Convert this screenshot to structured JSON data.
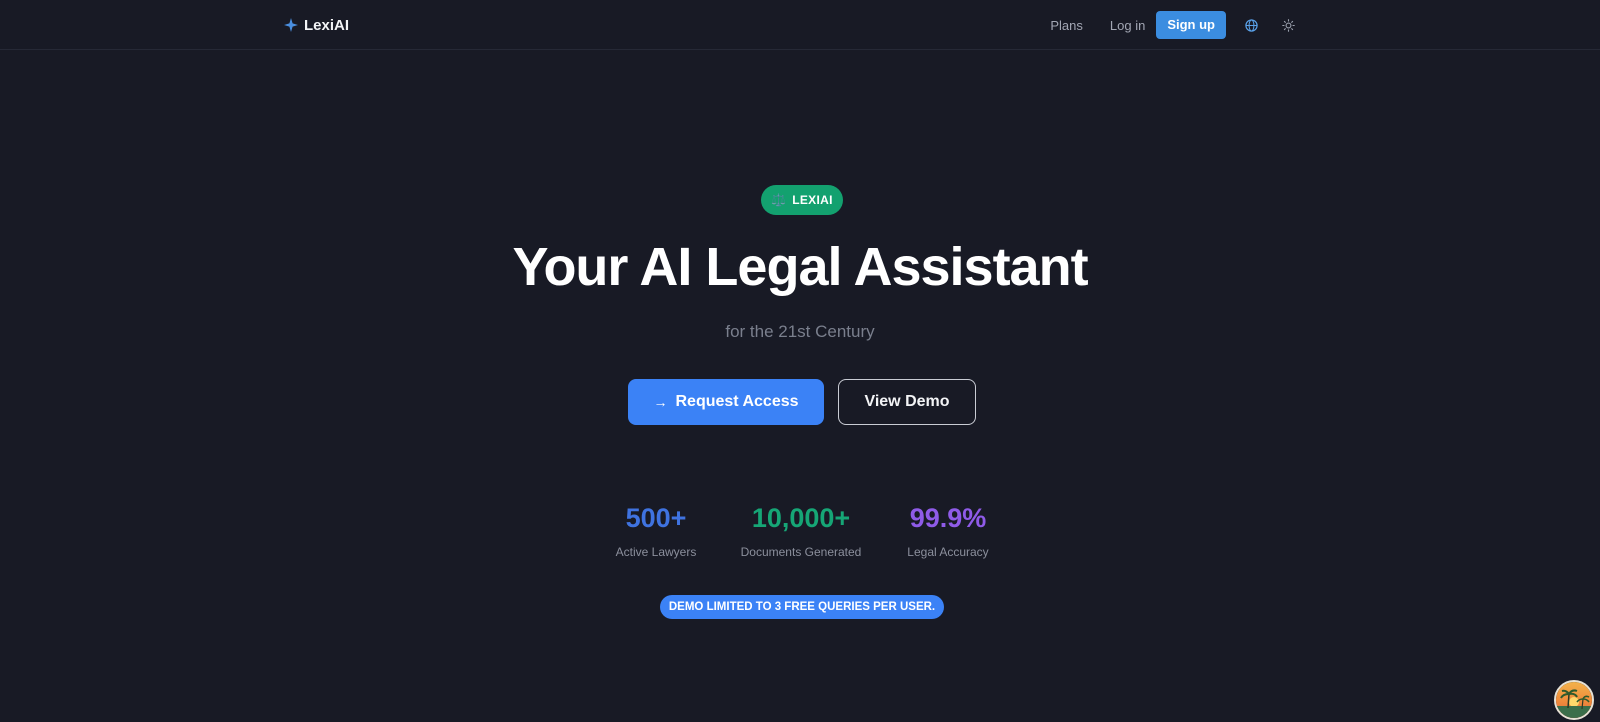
{
  "header": {
    "brand_name": "LexiAI",
    "nav": {
      "plans": "Plans",
      "login": "Log in",
      "signup": "Sign up"
    },
    "icons": [
      "sparkle-icon",
      "globe-icon",
      "sun-icon"
    ]
  },
  "hero": {
    "badge_icon": "⚖️",
    "badge_text": "LEXIAI",
    "title": "Your AI Legal Assistant",
    "subtitle": "for the 21st Century",
    "cta_primary_icon": "→",
    "cta_primary": "Request Access",
    "cta_secondary": "View Demo"
  },
  "stats": [
    {
      "value": "500+",
      "label": "Active Lawyers",
      "color": "#3f73e0"
    },
    {
      "value": "10,000+",
      "label": "Documents Generated",
      "color": "#16a676"
    },
    {
      "value": "99.9%",
      "label": "Legal Accuracy",
      "color": "#8f5be8"
    }
  ],
  "demo_notice": "DEMO LIMITED TO 3 FREE QUERIES PER USER.",
  "colors": {
    "background": "#181a25",
    "accent_blue": "#3b82f6",
    "signup_blue": "#3b8de0",
    "badge_green": "#13a16f"
  }
}
